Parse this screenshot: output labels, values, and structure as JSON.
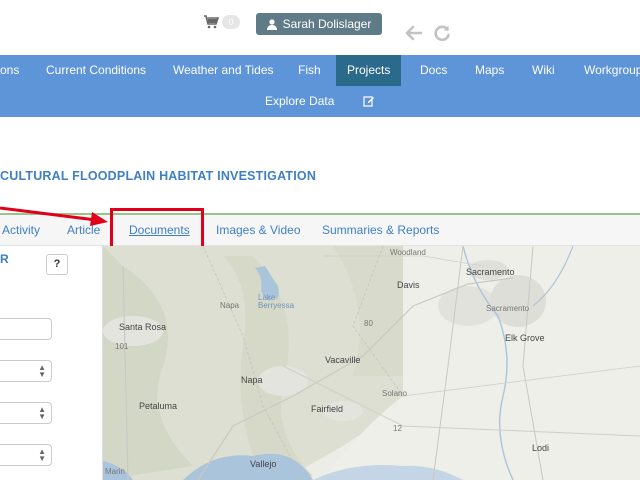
{
  "header": {
    "cart_count": "0",
    "user_name": "Sarah Dolislager",
    "icons": {
      "cart": "cart-icon",
      "user": "user-icon",
      "back": "back-arrow-icon",
      "reload": "reload-icon"
    }
  },
  "nav": {
    "items": [
      {
        "label": "ons"
      },
      {
        "label": "Current Conditions"
      },
      {
        "label": "Weather and Tides"
      },
      {
        "label": "Fish"
      },
      {
        "label": "Projects",
        "active": true
      },
      {
        "label": "Docs"
      },
      {
        "label": "Maps"
      },
      {
        "label": "Wiki"
      },
      {
        "label": "Workgroup"
      }
    ],
    "explore_label": "Explore Data",
    "edit_icon": "edit-icon",
    "colors": {
      "bar": "#5e94d8",
      "active": "#2c6a8c"
    }
  },
  "project": {
    "title": "CULTURAL FLOODPLAIN HABITAT INVESTIGATION"
  },
  "tabs": {
    "items": [
      {
        "label": "Activity"
      },
      {
        "label": "Article"
      },
      {
        "label": "Documents",
        "selected": true
      },
      {
        "label": "Images & Video"
      },
      {
        "label": "Summaries & Reports"
      }
    ]
  },
  "annotation": {
    "color": "#e0001b"
  },
  "sidebar": {
    "heading": "R",
    "help_label": "?",
    "input_value": "",
    "selects": [
      {
        "value": ""
      },
      {
        "value": ""
      },
      {
        "value": ""
      }
    ]
  },
  "map": {
    "labels": {
      "woodland": "Woodland",
      "davis": "Davis",
      "sacramento": "Sacramento",
      "sacramento_small": "Sacramento",
      "napa_small": "Napa",
      "lake_berryessa": "Lake Berryessa",
      "santa_rosa": "Santa Rosa",
      "elk_grove": "Elk Grove",
      "vacaville": "Vacaville",
      "napa": "Napa",
      "solano": "Solano",
      "petaluma": "Petaluma",
      "fairfield": "Fairfield",
      "lodi": "Lodi",
      "vallejo": "Vallejo",
      "marin": "Marin",
      "hwy_101": "101",
      "hwy_80": "80",
      "hwy_12": "12"
    }
  }
}
